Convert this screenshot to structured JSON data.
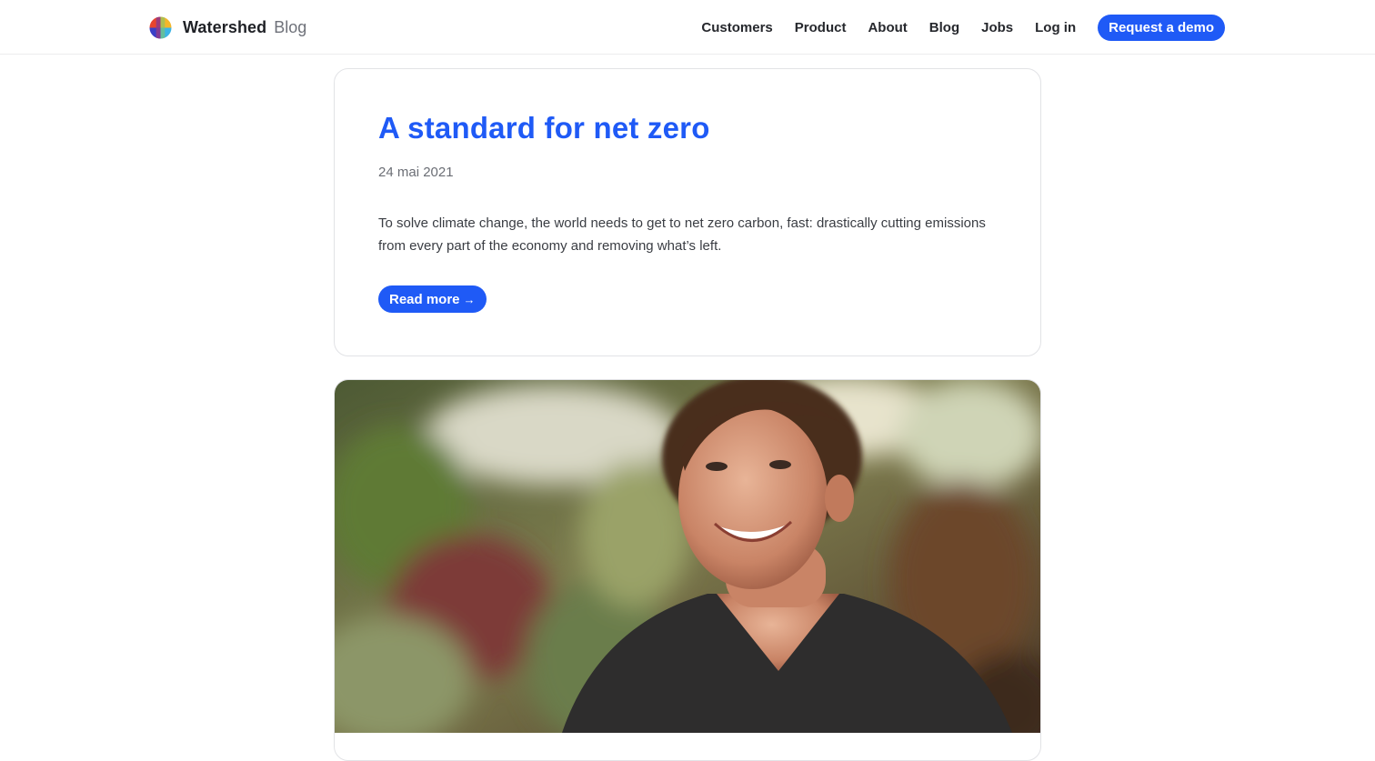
{
  "header": {
    "brand_name": "Watershed",
    "brand_sub": "Blog",
    "nav": [
      {
        "label": "Customers"
      },
      {
        "label": "Product"
      },
      {
        "label": "About"
      },
      {
        "label": "Blog"
      },
      {
        "label": "Jobs"
      },
      {
        "label": "Log in"
      }
    ],
    "cta_label": "Request a demo"
  },
  "post": {
    "title": "A standard for net zero",
    "date": "24 mai 2021",
    "excerpt": "To solve climate change, the world needs to get to net zero carbon, fast: drastically cutting emissions from every part of the economy and removing what’s left.",
    "read_more_label": "Read more",
    "read_more_arrow": "→"
  },
  "colors": {
    "accent": "#1f5af6",
    "text": "#24262b",
    "muted": "#6b6e75",
    "border": "#e2e3e6"
  },
  "icons": {
    "logo": "watershed-logo-icon",
    "arrow": "arrow-right-icon"
  }
}
